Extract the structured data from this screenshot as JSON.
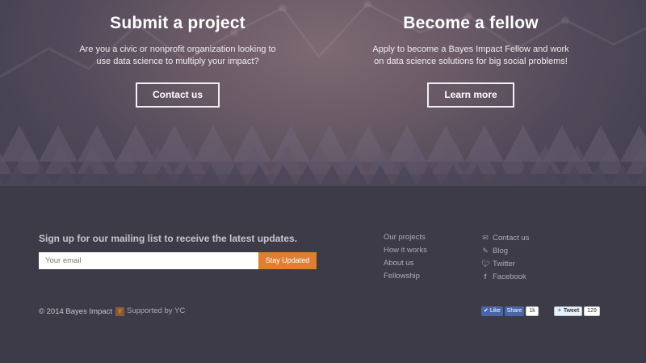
{
  "hero": {
    "left": {
      "title": "Submit a project",
      "line1": "Are you a civic or nonprofit organization looking to",
      "line2": "use data science to multiply your impact?",
      "button": "Contact us"
    },
    "right": {
      "title": "Become a fellow",
      "line1": "Apply to become a Bayes Impact Fellow and work",
      "line2": "on data science solutions for big social problems!",
      "button": "Learn more"
    }
  },
  "footer": {
    "signup_title": "Sign up for our mailing list to receive the latest updates.",
    "email_placeholder": "Your email",
    "stay_button": "Stay Updated",
    "links_col1": [
      "Our projects",
      "How it works",
      "About us",
      "Fellowship"
    ],
    "links_col2": [
      {
        "icon": "envelope-icon",
        "label": "Contact us"
      },
      {
        "icon": "pencil-icon",
        "label": "Blog"
      },
      {
        "icon": "twitter-icon",
        "label": "Twitter"
      },
      {
        "icon": "facebook-icon",
        "label": "Facebook"
      }
    ],
    "copyright": "© 2014 Bayes Impact",
    "supported": "Supported by YC",
    "yc_logo": "Y",
    "fb_like": "Like",
    "fb_share": "Share",
    "fb_count": "1k",
    "tweet": "Tweet",
    "tweet_count": "129"
  },
  "colors": {
    "accent": "#e07f33",
    "footer_bg": "#3e3b48",
    "facebook": "#4a66a9"
  }
}
